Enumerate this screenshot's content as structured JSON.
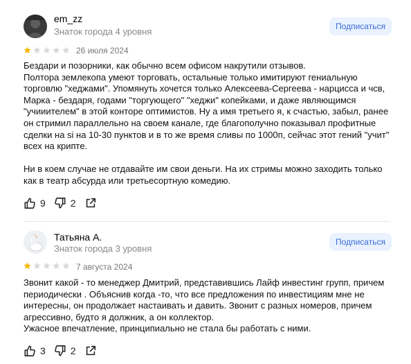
{
  "reviews": [
    {
      "author": "em_zz",
      "level": "Знаток города 4 уровня",
      "subscribe_label": "Подписаться",
      "rating": 1,
      "date": "26 июля 2024",
      "text": "Бездари и позорники, как обычно всем офисом накрутили отзывов.\nПолтора землекопа умеют торговать, остальные только имитируют гениальную торговлю \"хеджами\". Упомянуть хочется только Алексеева-Сергеева - нарцисса и чсв, Марка - бездаря, годами \"торгующего\" \"хеджи\" копейками, и даже являющимся \"учииителем\" в этой конторе оптимистов. Ну а имя третьего я, к счастью, забыл, ранее он стримил параллельно на своем канале, где благополучно показывал профитные сделки на si на 10-30 пунктов и в то же время сливы по 1000п, сейчас этот гений \"учит\" всех на крипте.\n\nНи в коем случае не отдавайте им свои деньги. На их стримы можно заходить только как в театр абсурда или третьесортную комедию.",
      "likes": "9",
      "dislikes": "2",
      "avatar_icon": "dark-photo-avatar"
    },
    {
      "author": "Татьяна А.",
      "level": "Знаток города 3 уровня",
      "subscribe_label": "Подписаться",
      "rating": 1,
      "date": "7 августа 2024",
      "text": "Звонит какой - то менеджер Дмитрий, представившись Лайф инвестинг групп, причем периодически . Объяснив когда -то, что все предложения по инвестициям мне не интересны, он продолжает настаивать и давить. Звонит с разных номеров, причем агрессивно, будто я должник, а он коллектор.\nУжасное впечатление, принципиально не стала бы работать с ними.",
      "likes": "3",
      "dislikes": "2",
      "avatar_icon": "goose-avatar"
    }
  ],
  "colors": {
    "star_filled": "#f6b800",
    "star_empty": "#d9d9d9",
    "subscribe_bg": "#eaf2ff",
    "subscribe_text": "#3a6bd6"
  }
}
